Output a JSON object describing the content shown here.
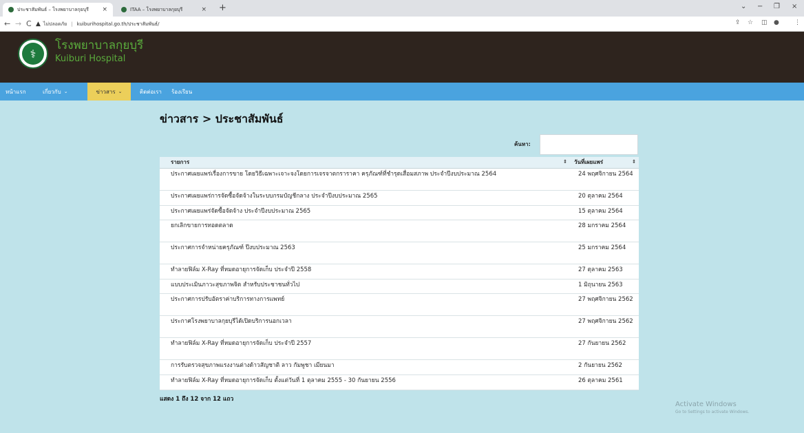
{
  "browser": {
    "tabs": [
      {
        "title": "ประชาสัมพันธ์ – โรงพยาบาลกุยบุรี",
        "active": true
      },
      {
        "title": "ITAA – โรงพยาบาลกุยบุรี",
        "active": false
      }
    ],
    "tab_close": "×",
    "new_tab": "+",
    "window_controls": {
      "chevron": "⌄",
      "minimize": "−",
      "restore": "❐",
      "close": "×"
    },
    "address": {
      "security_label": "ไม่ปลอดภัย",
      "url": "kuiburihospital.go.th/ประชาสัมพันธ์/"
    },
    "nav_buttons": {
      "back": "←",
      "forward": "→",
      "reload": "C"
    },
    "toolbar_icons": {
      "share": "⇪",
      "bookmark": "☆",
      "sidebar": "◫",
      "profile": "●",
      "menu": "⋮"
    }
  },
  "site": {
    "title": "โรงพยาบาลกุยบุรี",
    "subtitle": "Kuiburi Hospital"
  },
  "nav": {
    "items": [
      {
        "label": "หน้าแรก",
        "dropdown": false
      },
      {
        "label": "เกี่ยวกับ",
        "dropdown": true
      },
      {
        "label": "ข่าวสาร",
        "dropdown": true
      },
      {
        "label": "ติดต่อเรา",
        "dropdown": false
      },
      {
        "label": "ร้องเรียน",
        "dropdown": false
      }
    ],
    "caret": "⌄"
  },
  "page": {
    "title": "ข่าวสาร > ประชาสัมพันธ์",
    "search_label": "ค้นหา:",
    "search_value": "",
    "columns": [
      "รายการ",
      "วันที่เผยแพร่"
    ],
    "sort_icon": "⇕",
    "rows": [
      {
        "title": "ประกาศเผยแพร่เรื่องการขาย โดยวิธีเฉพาะเจาะจงโดยการเจรจาตกราราคา ครุภัณฑ์ที่ชำรุดเสื่อมสภาพ ประจำปีงบประมาณ 2564",
        "date": "24 พฤศจิกายน 2564"
      },
      {
        "title": "ประกาศเผยแพร่การจัดซื้อจัดจ้างในระบบกรมบัญชีกลาง ประจำปีงบประมาณ 2565",
        "date": "20 ตุลาคม 2564"
      },
      {
        "title": "ประกาศเผยแพร่จัดซื้อจัดจ้าง ประจำปีงบประมาณ 2565",
        "date": "15 ตุลาคม 2564"
      },
      {
        "title": "ยกเลิกขายการทอดตลาด",
        "date": "28 มกราคม 2564"
      },
      {
        "title": "ประกาศการจำหน่ายครุภัณฑ์ ปีงบประมาณ 2563",
        "date": "25 มกราคม 2564"
      },
      {
        "title": "ทำลายฟิล์ม X-Ray ที่หมดอายุการจัดเก็บ ประจำปี 2558",
        "date": "27 ตุลาคม 2563"
      },
      {
        "title": "แบบประเมินภาวะสุขภาพจิต สำหรับประชาชนทั่วไป",
        "date": "1 มิถุนายน 2563"
      },
      {
        "title": "ประกาศการปรับอัตราค่าบริการทางการแพทย์",
        "date": "27 พฤศจิกายน 2562"
      },
      {
        "title": "ประกาศโรงพยาบาลกุยบุรีได้เปิดบริการนอกเวลา",
        "date": "27 พฤศจิกายน 2562"
      },
      {
        "title": "ทำลายฟิล์ม X-Ray ที่หมดอายุการจัดเก็บ ประจำปี 2557",
        "date": "27 กันยายน 2562"
      },
      {
        "title": "การรับตรวจสุขภาพแรงงานต่างด้าวสัญชาติ ลาว กัมพูชา เมียนมา",
        "date": "2 กันยายน 2562"
      },
      {
        "title": "ทำลายฟิล์ม X-Ray ที่หมดอายุการจัดเก็บ ตั้งแต่วันที่ 1 ตุลาคม 2555 - 30 กันยายน 2556",
        "date": "26 ตุลาคม 2561"
      }
    ],
    "info": "แสดง 1 ถึง 12 จาก 12 แถว"
  },
  "watermark": {
    "line1": "Activate Windows",
    "line2": "Go to Settings to activate Windows."
  }
}
